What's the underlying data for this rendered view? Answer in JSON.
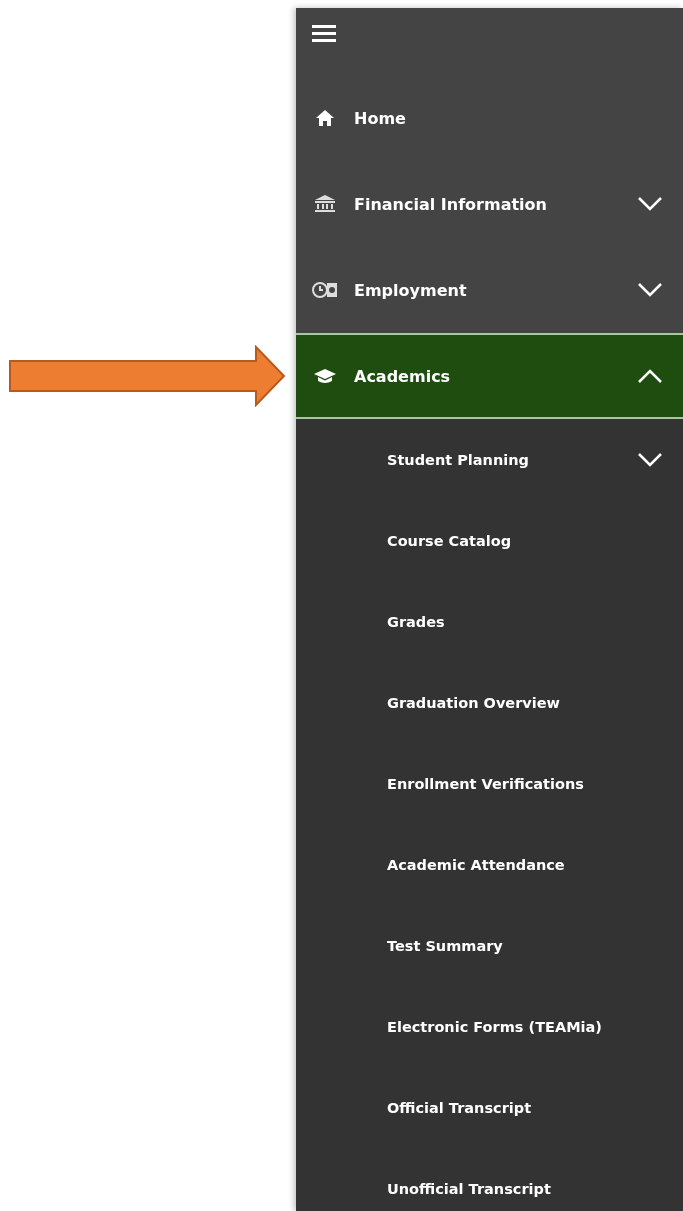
{
  "nav_items": [
    {
      "label": "Home",
      "selected": false,
      "expandable": false
    },
    {
      "label": "Financial Information",
      "selected": false,
      "expandable": true,
      "expanded": false
    },
    {
      "label": "Employment",
      "selected": false,
      "expandable": true,
      "expanded": false
    },
    {
      "label": "Academics",
      "selected": true,
      "expandable": true,
      "expanded": true,
      "children": [
        {
          "label": "Student Planning",
          "selected": false,
          "expandable": true,
          "expanded": false
        },
        {
          "label": "Course Catalog",
          "selected": false,
          "expandable": false
        },
        {
          "label": "Grades",
          "selected": false,
          "expandable": false
        },
        {
          "label": "Graduation Overview",
          "selected": false,
          "expandable": false
        },
        {
          "label": "Enrollment Verifications",
          "selected": false,
          "expandable": false
        },
        {
          "label": "Academic Attendance",
          "selected": false,
          "expandable": false
        },
        {
          "label": "Test Summary",
          "selected": false,
          "expandable": false
        },
        {
          "label": "Electronic Forms (TEAMia)",
          "selected": false,
          "expandable": false
        },
        {
          "label": "Official Transcript",
          "selected": false,
          "expandable": false
        },
        {
          "label": "Unofficial Transcript",
          "selected": false,
          "expandable": false
        }
      ]
    }
  ]
}
